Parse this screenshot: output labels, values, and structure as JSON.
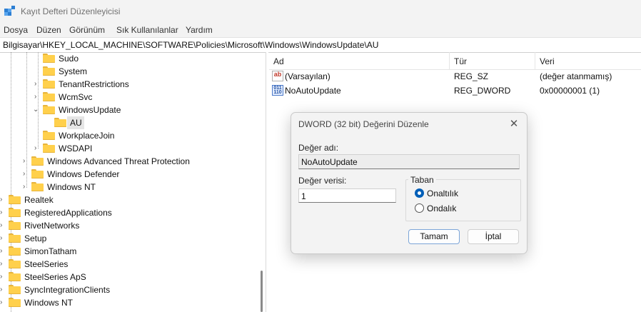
{
  "window": {
    "title": "Kayıt Defteri Düzenleyicisi"
  },
  "menu": [
    "Dosya",
    "Düzen",
    "Görünüm",
    "Sık Kullanılanlar",
    "Yardım"
  ],
  "address": "Bilgisayar\\HKEY_LOCAL_MACHINE\\SOFTWARE\\Policies\\Microsoft\\Windows\\WindowsUpdate\\AU",
  "tree": [
    {
      "label": "Sudo"
    },
    {
      "label": "System"
    },
    {
      "label": "TenantRestrictions"
    },
    {
      "label": "WcmSvc"
    },
    {
      "label": "WindowsUpdate"
    },
    {
      "label": "AU"
    },
    {
      "label": "WorkplaceJoin"
    },
    {
      "label": "WSDAPI"
    },
    {
      "label": "Windows Advanced Threat Protection"
    },
    {
      "label": "Windows Defender"
    },
    {
      "label": "Windows NT"
    },
    {
      "label": "Realtek"
    },
    {
      "label": "RegisteredApplications"
    },
    {
      "label": "RivetNetworks"
    },
    {
      "label": "Setup"
    },
    {
      "label": "SimonTatham"
    },
    {
      "label": "SteelSeries"
    },
    {
      "label": "SteelSeries ApS"
    },
    {
      "label": "SyncIntegrationClients"
    },
    {
      "label": "Windows NT"
    }
  ],
  "list": {
    "columns": [
      "Ad",
      "Tür",
      "Veri"
    ],
    "rows": [
      {
        "icon": "ab",
        "name": "(Varsayılan)",
        "type": "REG_SZ",
        "data": "(değer atanmamış)"
      },
      {
        "icon": "dword",
        "name": "NoAutoUpdate",
        "type": "REG_DWORD",
        "data": "0x00000001 (1)"
      }
    ]
  },
  "dialog": {
    "title": "DWORD (32 bit) Değerini Düzenle",
    "name_label": "Değer adı:",
    "name_value": "NoAutoUpdate",
    "data_label": "Değer verisi:",
    "data_value": "1",
    "base_label": "Taban",
    "base_options": [
      "Onaltılık",
      "Ondalık"
    ],
    "base_selected": "Onaltılık",
    "ok": "Tamam",
    "cancel": "İptal"
  },
  "colors": {
    "accent": "#005fb8",
    "folder": "#ffd04c",
    "selection": "#e5e5e5"
  }
}
